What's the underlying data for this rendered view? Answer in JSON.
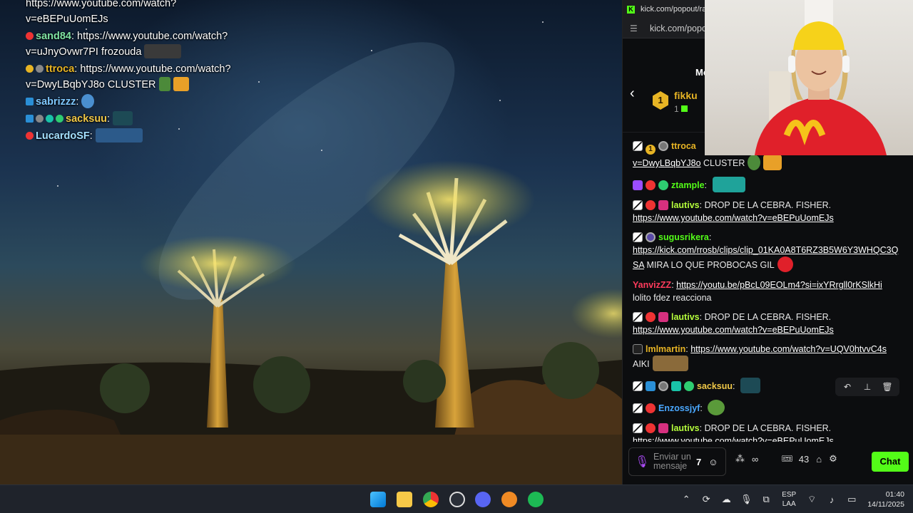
{
  "overlay_chat": [
    {
      "name": "",
      "name_color": "",
      "text": "https://www.youtube.com/watch?",
      "text2": "v=eBEPuUomEJs"
    },
    {
      "name": "sand84",
      "name_color": "#7fe3a3",
      "text": "https://www.youtube.com/watch?",
      "text2": "v=uJnyOvwr7PI frozouda"
    },
    {
      "name": "ttroca",
      "name_color": "#e7b424",
      "text": "https://www.youtube.com/watch?",
      "text2": "v=DwyLBqbYJ8o CLUSTER"
    },
    {
      "name": "sabrizzz",
      "name_color": "#7fc8ff",
      "text": "",
      "text2": ""
    },
    {
      "name": "sacksuu",
      "name_color": "#f0c848",
      "text": "",
      "text2": ""
    },
    {
      "name": "LucardoSF",
      "name_color": "#a4e0ff",
      "text": "",
      "text2": ""
    }
  ],
  "browser": {
    "tab_title": "kick.com/popout/rage",
    "address": "kick.com/popout",
    "mod_label": "Mo",
    "pinned": {
      "rank": "1",
      "name": "fikku",
      "count": "1"
    }
  },
  "messages": [
    {
      "user": "ttroca",
      "color": "#e7b424",
      "text": "",
      "link": "",
      "line2_link": "v=DwyLBqbYJ8o",
      "line2_text": "CLUSTER"
    },
    {
      "user": "ztample",
      "color": "#53fc18",
      "text": "",
      "link": "",
      "line2_link": "",
      "line2_text": ""
    },
    {
      "user": "lautivs",
      "color": "#b6ff3c",
      "text": "DROP DE LA CEBRA. FISHER.",
      "link": "",
      "line2_link": "https://www.youtube.com/watch?v=eBEPuUomEJs",
      "line2_text": ""
    },
    {
      "user": "sugusrikera",
      "color": "#53fc18",
      "text": "",
      "link": "",
      "line2_link": "https://kick.com/rrosb/clips/clip_01KA0A8T6RZ3B5W6Y3WHQC3QSA",
      "line2_text": "MIRA LO QUE PROBOCAS GIL"
    },
    {
      "user": "YanvizZZ",
      "color": "#ff3b5c",
      "text": "",
      "link": "https://youtu.be/pBcL09EOLm4?si=ixYRrgll0rKSlkHi",
      "line2_link": "",
      "line2_text": "lolito fdez reacciona"
    },
    {
      "user": "lautivs",
      "color": "#b6ff3c",
      "text": "DROP DE LA CEBRA. FISHER.",
      "link": "",
      "line2_link": "https://www.youtube.com/watch?v=eBEPuUomEJs",
      "line2_text": ""
    },
    {
      "user": "lmlmartin",
      "color": "#e7b424",
      "text": "",
      "link": "https://www.youtube.com/watch?v=UQV0htvvC4s",
      "line2_link": "",
      "line2_text": "AIKI"
    },
    {
      "user": "sacksuu",
      "color": "#f0c848",
      "text": "",
      "link": "",
      "line2_link": "",
      "line2_text": ""
    },
    {
      "user": "Enzossjyf",
      "color": "#4aa8ff",
      "text": "",
      "link": "",
      "line2_link": "",
      "line2_text": ""
    },
    {
      "user": "lautivs",
      "color": "#b6ff3c",
      "text": "DROP DE LA CEBRA. FISHER.",
      "link": "",
      "line2_link": "https://www.youtube.com/watch?v=eBEPuUomEJs",
      "line2_text": ""
    }
  ],
  "composer": {
    "placeholder": "Enviar un mensaje",
    "emote_label": "7",
    "points": "43",
    "chat_button": "Chat"
  },
  "taskbar": {
    "lang": "ESP",
    "lang2": "LAA",
    "time": "01:40",
    "date": "14/11/2025"
  },
  "colors": {
    "kick_green": "#53fc18",
    "gold": "#e7b424"
  }
}
